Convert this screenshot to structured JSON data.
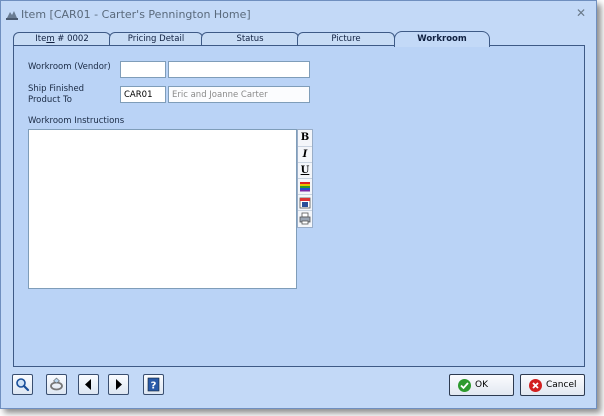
{
  "window": {
    "title": "Item [CAR01 - Carter's Pennington Home]"
  },
  "tabs": [
    {
      "label_pre": "Ite",
      "label_u": "m",
      "label_post": " # 0002"
    },
    {
      "label": "Pricing Detail"
    },
    {
      "label": "Status"
    },
    {
      "label": "Picture"
    },
    {
      "label": "Workroom"
    }
  ],
  "form": {
    "vendor_label": "Workroom (Vendor)",
    "vendor_code": "",
    "vendor_name": "",
    "ship_label_1": "Ship Finished",
    "ship_label_2": "Product To",
    "ship_code": "CAR01",
    "ship_name": "Eric and Joanne Carter",
    "instructions_label": "Workroom Instructions",
    "instructions_text": ""
  },
  "format_toolbar": {
    "bold": "B",
    "italic": "I",
    "underline": "U"
  },
  "footer": {
    "ok_label": "OK",
    "cancel_label": "Cancel"
  },
  "colors": {
    "window_bg": "#c3d9f7",
    "panel_bg": "#bad3f6",
    "border": "#3e5a86",
    "ok_icon": "#2e9a2e",
    "cancel_icon": "#d22020"
  },
  "icons": [
    "window-app-icon",
    "close-icon",
    "bold-icon",
    "italic-icon",
    "underline-icon",
    "color-bars-icon",
    "calendar-icon",
    "print-icon",
    "search-icon",
    "ring-icon",
    "arrow-left-icon",
    "arrow-right-icon",
    "help-icon",
    "checkmark-icon",
    "cancel-x-icon"
  ]
}
